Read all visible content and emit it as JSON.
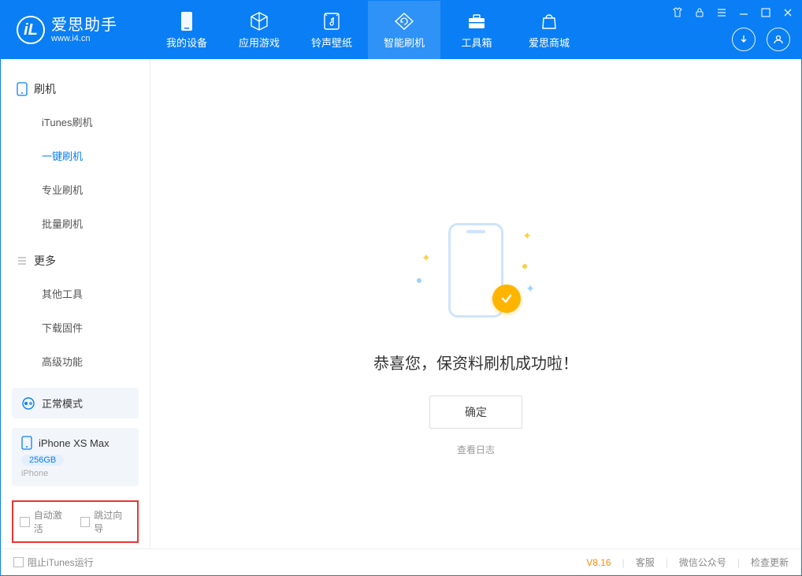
{
  "app": {
    "name_cn": "爱思助手",
    "name_en": "www.i4.cn",
    "logo_letter": "iL"
  },
  "tabs": [
    {
      "label": "我的设备"
    },
    {
      "label": "应用游戏"
    },
    {
      "label": "铃声壁纸"
    },
    {
      "label": "智能刷机"
    },
    {
      "label": "工具箱"
    },
    {
      "label": "爱思商城"
    }
  ],
  "sidebar": {
    "section1": {
      "title": "刷机",
      "items": [
        "iTunes刷机",
        "一键刷机",
        "专业刷机",
        "批量刷机"
      ],
      "active": 1
    },
    "section2": {
      "title": "更多",
      "items": [
        "其他工具",
        "下载固件",
        "高级功能"
      ]
    },
    "mode": "正常模式",
    "device": {
      "name": "iPhone XS Max",
      "storage": "256GB",
      "type": "iPhone"
    },
    "checks": {
      "auto_activate": "自动激活",
      "skip_guide": "跳过向导"
    }
  },
  "main": {
    "success_msg": "恭喜您，保资料刷机成功啦！",
    "ok": "确定",
    "log": "查看日志"
  },
  "footer": {
    "block_itunes": "阻止iTunes运行",
    "version": "V8.16",
    "service": "客服",
    "wechat": "微信公众号",
    "update": "检查更新"
  }
}
